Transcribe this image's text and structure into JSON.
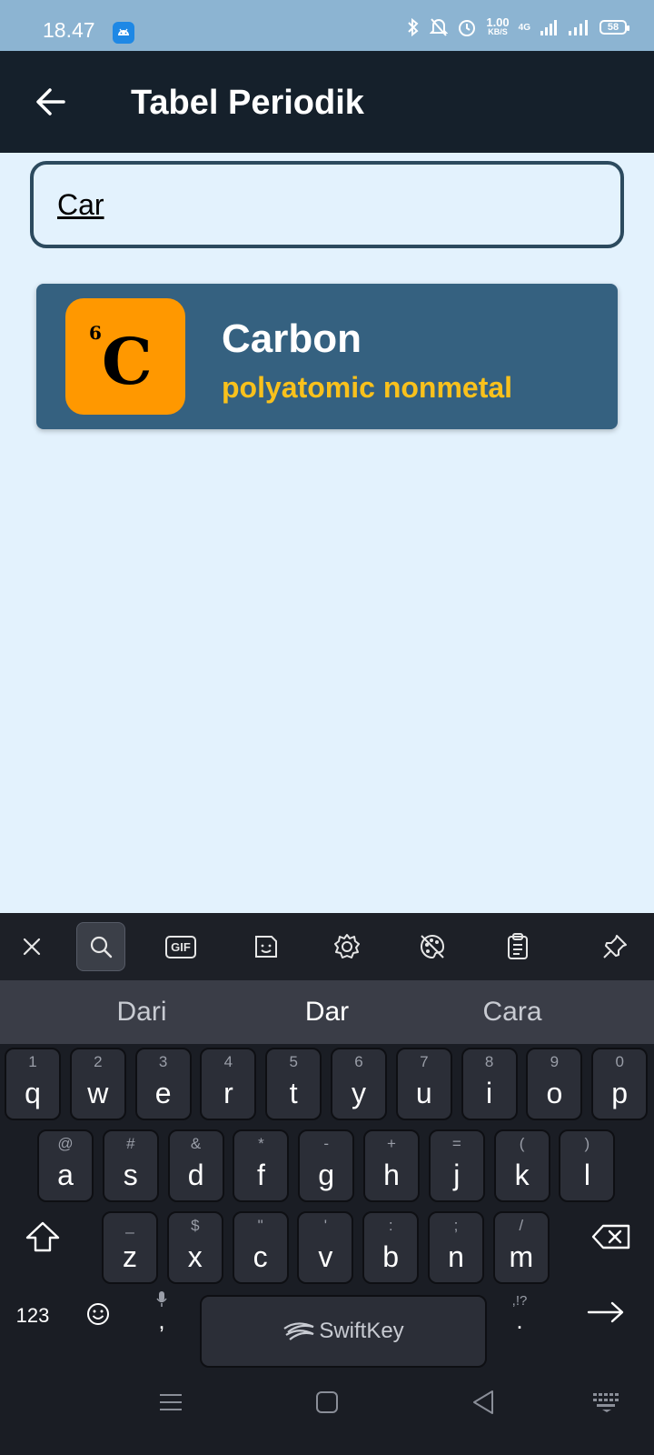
{
  "status_bar": {
    "time": "18.47",
    "speed_value": "1.00",
    "speed_unit": "KB/S",
    "network": "4G",
    "battery": "58"
  },
  "app_bar": {
    "title": "Tabel Periodik"
  },
  "search": {
    "value": "Car"
  },
  "results": [
    {
      "atomic_number": "6",
      "symbol": "C",
      "name": "Carbon",
      "category": "polyatomic nonmetal",
      "tile_color": "#ff9800",
      "category_color": "#f9c11c"
    }
  ],
  "keyboard": {
    "suggestions": [
      "Dari",
      "Dar",
      "Cara"
    ],
    "row1": [
      {
        "hint": "1",
        "key": "q"
      },
      {
        "hint": "2",
        "key": "w"
      },
      {
        "hint": "3",
        "key": "e"
      },
      {
        "hint": "4",
        "key": "r"
      },
      {
        "hint": "5",
        "key": "t"
      },
      {
        "hint": "6",
        "key": "y"
      },
      {
        "hint": "7",
        "key": "u"
      },
      {
        "hint": "8",
        "key": "i"
      },
      {
        "hint": "9",
        "key": "o"
      },
      {
        "hint": "0",
        "key": "p"
      }
    ],
    "row2": [
      {
        "hint": "@",
        "key": "a"
      },
      {
        "hint": "#",
        "key": "s"
      },
      {
        "hint": "&",
        "key": "d"
      },
      {
        "hint": "*",
        "key": "f"
      },
      {
        "hint": "-",
        "key": "g"
      },
      {
        "hint": "+",
        "key": "h"
      },
      {
        "hint": "=",
        "key": "j"
      },
      {
        "hint": "(",
        "key": "k"
      },
      {
        "hint": ")",
        "key": "l"
      }
    ],
    "row3": [
      {
        "hint": "_",
        "key": "z"
      },
      {
        "hint": "$",
        "key": "x"
      },
      {
        "hint": "\"",
        "key": "c"
      },
      {
        "hint": "'",
        "key": "v"
      },
      {
        "hint": ":",
        "key": "b"
      },
      {
        "hint": ";",
        "key": "n"
      },
      {
        "hint": "/",
        "key": "m"
      }
    ],
    "numbers_label": "123",
    "comma": ",",
    "period": ".",
    "period_hint": ",!?",
    "space_label": "SwiftKey",
    "toolbar_gif": "GIF"
  },
  "colors": {
    "app_bar": "#15202b",
    "background": "#e3f2fd",
    "card": "#356180",
    "keyboard": "#1a1d24"
  }
}
